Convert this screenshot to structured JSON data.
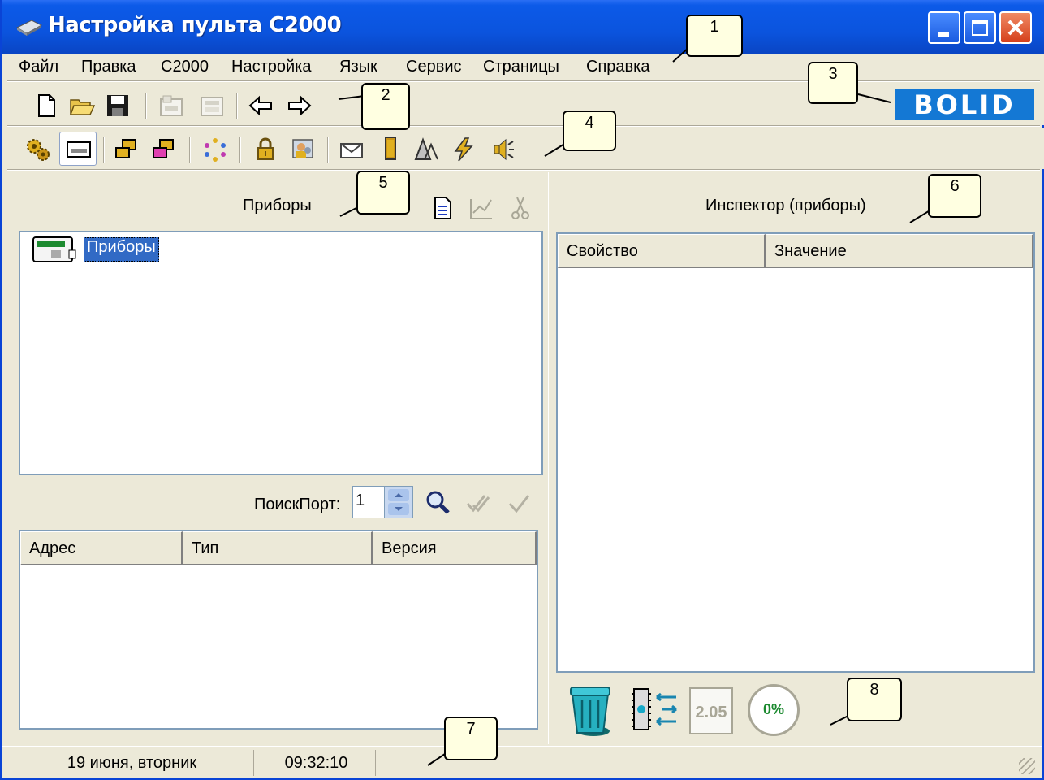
{
  "window": {
    "title": "Настройка пульта С2000"
  },
  "menu": {
    "items": [
      "Файл",
      "Правка",
      "С2000",
      "Настройка",
      "Язык",
      "Сервис",
      "Страницы",
      "Справка"
    ]
  },
  "logo": {
    "text": "BOLID"
  },
  "callouts": [
    "1",
    "2",
    "3",
    "4",
    "5",
    "6",
    "7",
    "8"
  ],
  "devices_panel": {
    "title": "Приборы",
    "tree_root": "Приборы"
  },
  "search": {
    "label": "ПоискПорт:",
    "port_value": "1",
    "columns": [
      "Адрес",
      "Тип",
      "Версия"
    ]
  },
  "inspector": {
    "title": "Инспектор (приборы)",
    "columns": [
      "Свойство",
      "Значение"
    ]
  },
  "bottom_tools": {
    "version_label": "2.05",
    "progress_label": "0%"
  },
  "status": {
    "date": "19 июня, вторник",
    "time": "09:32:10"
  },
  "colors": {
    "titlebar": "#0b54de",
    "face": "#ece9d8",
    "selection": "#316ac5",
    "logo": "#1478d4",
    "callout": "#ffffe1"
  },
  "icons": [
    "window-icon",
    "new-file-icon",
    "open-folder-icon",
    "save-icon",
    "device-read-icon",
    "device-write-icon",
    "arrow-left-icon",
    "arrow-right-icon",
    "gears-icon",
    "keyboard-icon",
    "copy-pages-icon",
    "paste-pages-icon",
    "cycle-icon",
    "lock-icon",
    "users-icon",
    "envelope-icon",
    "door-icon",
    "relay-icon",
    "lightning-icon",
    "speaker-icon",
    "document-icon",
    "edit-chart-icon",
    "scissors-icon",
    "magnifier-icon",
    "check-double-icon",
    "check-icon",
    "trash-icon",
    "chip-transfer-icon",
    "version-icon",
    "progress-icon"
  ]
}
